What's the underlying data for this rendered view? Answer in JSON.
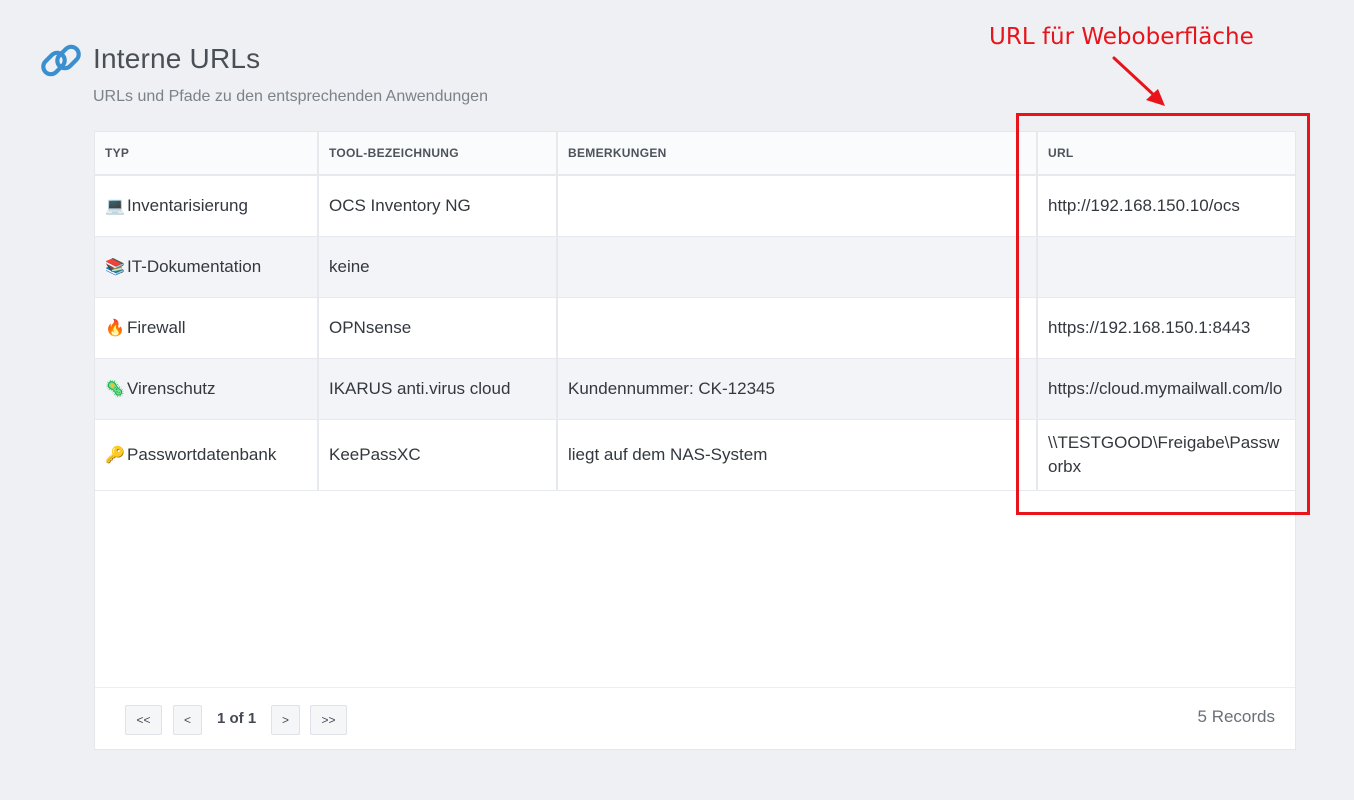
{
  "header": {
    "title": "Interne URLs",
    "subtitle": "URLs und Pfade zu den entsprechenden Anwendungen",
    "icon": "link-icon",
    "icon_color": "#3a8fd0"
  },
  "table": {
    "columns": [
      "TYP",
      "TOOL-BEZEICHNUNG",
      "BEMERKUNGEN",
      "URL"
    ],
    "rows": [
      {
        "emoji": "💻",
        "icon": "laptop-icon",
        "typ": "Inventarisierung",
        "tool": "OCS Inventory NG",
        "bemerkung": "",
        "url": "http://192.168.150.10/ocs"
      },
      {
        "emoji": "📚",
        "icon": "books-icon",
        "typ": "IT-Dokumentation",
        "tool": "keine",
        "bemerkung": "",
        "url": ""
      },
      {
        "emoji": "🔥",
        "icon": "fire-icon",
        "typ": "Firewall",
        "tool": "OPNsense",
        "bemerkung": "",
        "url": "https://192.168.150.1:8443"
      },
      {
        "emoji": "🦠",
        "icon": "microbe-icon",
        "typ": "Virenschutz",
        "tool": "IKARUS anti.virus cloud",
        "bemerkung": "Kundennummer: CK-12345",
        "url": "https://cloud.mymailwall.com/lo"
      },
      {
        "emoji": "🔑",
        "icon": "key-icon",
        "typ": "Passwortdatenbank",
        "tool": "KeePassXC",
        "bemerkung": "liegt auf dem NAS-System",
        "url": "\\\\TESTGOOD\\Freigabe\\Passworbx"
      }
    ]
  },
  "pagination": {
    "first": "<<",
    "prev": "<",
    "page_label": "1 of 1",
    "next": ">",
    "last": ">>",
    "records": "5 Records"
  },
  "annotation": {
    "label": "URL für Weboberfläche",
    "color": "#e8141b"
  }
}
